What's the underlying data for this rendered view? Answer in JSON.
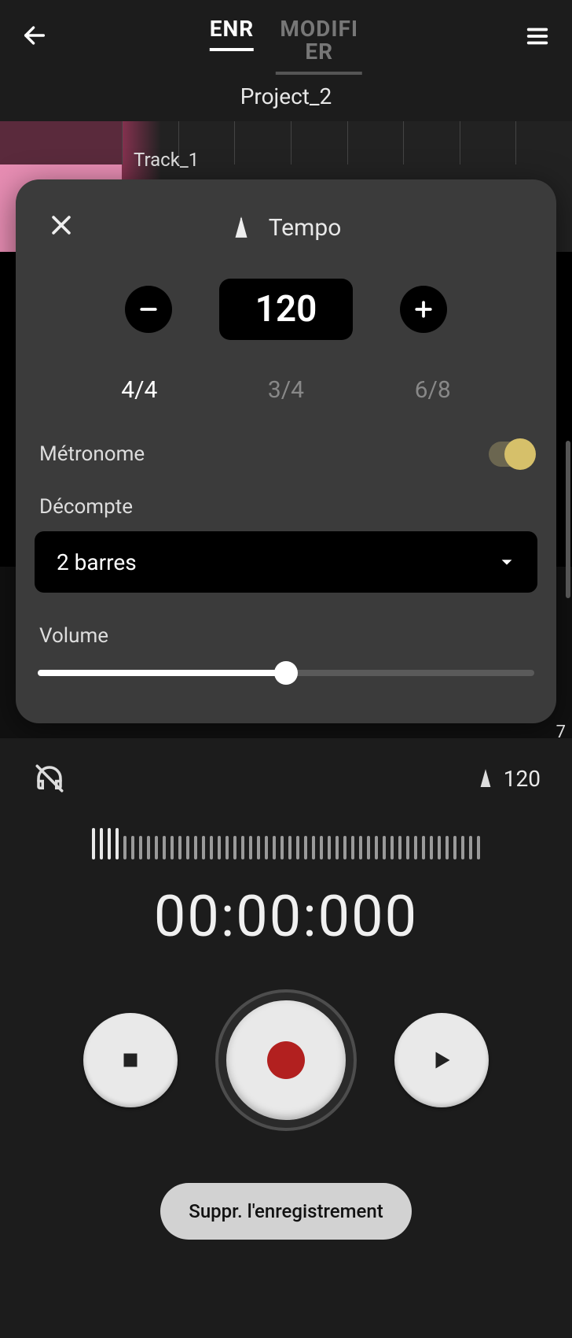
{
  "header": {
    "tab_active": "ENR",
    "tab_secondary": "MODIFIER"
  },
  "project_name": "Project_2",
  "track_name": "Track_1",
  "modal": {
    "title": "Tempo",
    "tempo_value": "120",
    "signatures": {
      "a": "4/4",
      "b": "3/4",
      "c": "6/8",
      "active": "a"
    },
    "metronome_label": "Métronome",
    "metronome_on": true,
    "decompte_label": "Décompte",
    "decompte_value": "2 barres",
    "volume_label": "Volume",
    "volume_pct": 50
  },
  "stray": "7",
  "panel": {
    "tempo_display": "120",
    "timer": "00:00:000",
    "delete_label": "Suppr. l'enregistrement"
  }
}
